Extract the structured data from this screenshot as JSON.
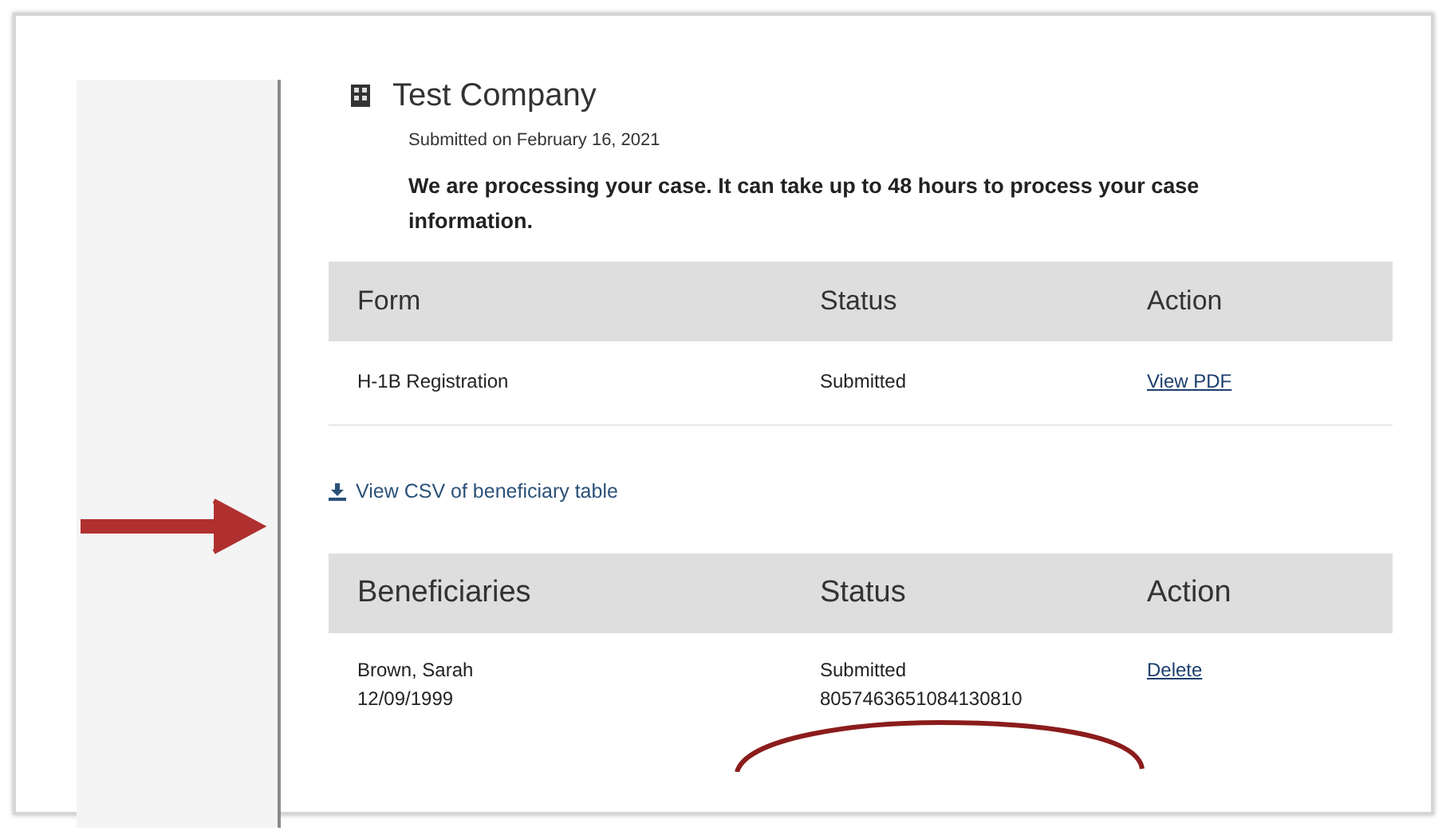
{
  "company": {
    "name": "Test Company",
    "submitted": "Submitted on February 16, 2021",
    "message": "We are processing your case. It can take up to 48 hours to process your case information."
  },
  "forms_table": {
    "columns": [
      "Form",
      "Status",
      "Action"
    ],
    "rows": [
      {
        "form": "H-1B Registration",
        "status": "Submitted",
        "action": "View PDF"
      }
    ]
  },
  "csv_link": "View CSV of beneficiary table",
  "beneficiaries_table": {
    "columns": [
      "Beneficiaries",
      "Status",
      "Action"
    ],
    "rows": [
      {
        "name": "Brown, Sarah",
        "date": "12/09/1999",
        "status": "Submitted",
        "number": "8057463651084130810",
        "action": "Delete"
      }
    ]
  }
}
